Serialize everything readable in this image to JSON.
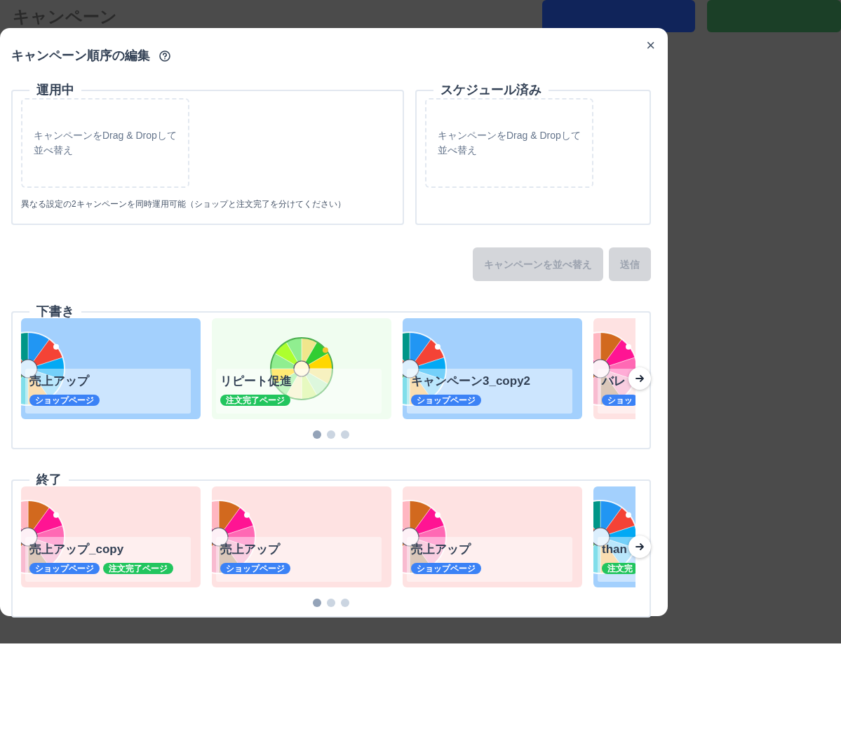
{
  "background": {
    "title": "キャンペーン"
  },
  "modal": {
    "title": "キャンペーン順序の編集",
    "close": "×"
  },
  "sections": [
    {
      "legend": "運用中",
      "drop_text": "キャンペーンをDrag & Dropして並べ替え",
      "note": "異なる設定の2キャンペーンを同時運用可能（ショップと注文完了を分けてください）"
    },
    {
      "legend": "スケジュール済み",
      "drop_text": "キャンペーンをDrag & Dropして並べ替え"
    }
  ],
  "buttons": [
    {
      "label": "キャンペーンを並べ替え",
      "disabled": true
    },
    {
      "label": "送信",
      "disabled": true
    }
  ],
  "carousels": [
    {
      "legend": "下書き",
      "cards": [
        {
          "title": "売上アップ",
          "color": "#a3d0fd",
          "kind": "blue",
          "tags": [
            {
              "label": "ショップページ",
              "kind": "shop"
            }
          ]
        },
        {
          "title": "リピート促進",
          "color": "#f0fdf0",
          "kind": "green",
          "tags": [
            {
              "label": "注文完了ページ",
              "kind": "order"
            }
          ]
        },
        {
          "title": "キャンペーン3_copy2",
          "color": "#a3d0fd",
          "kind": "blue",
          "tags": [
            {
              "label": "ショップページ",
              "kind": "shop"
            }
          ]
        },
        {
          "title": "バレ",
          "color": "#fee2e2",
          "kind": "pink",
          "tags": [
            {
              "label": "ショッ",
              "kind": "shop"
            }
          ]
        }
      ],
      "dots": [
        {
          "selected": true
        },
        {
          "selected": false
        },
        {
          "selected": false
        }
      ]
    },
    {
      "legend": "終了",
      "cards": [
        {
          "title": "売上アップ_copy",
          "color": "#fee2e2",
          "kind": "pink",
          "tags": [
            {
              "label": "ショップページ",
              "kind": "shop"
            },
            {
              "label": "注文完了ページ",
              "kind": "order"
            }
          ]
        },
        {
          "title": "売上アップ",
          "color": "#fee2e2",
          "kind": "pink",
          "tags": [
            {
              "label": "ショップページ",
              "kind": "shop"
            }
          ]
        },
        {
          "title": "売上アップ",
          "color": "#fee2e2",
          "kind": "pink",
          "tags": [
            {
              "label": "ショップページ",
              "kind": "shop"
            }
          ]
        },
        {
          "title": "than",
          "color": "#a3d0fd",
          "kind": "blue",
          "tags": [
            {
              "label": "注文完",
              "kind": "order"
            }
          ]
        }
      ],
      "dots": [
        {
          "selected": true
        },
        {
          "selected": false
        },
        {
          "selected": false
        }
      ]
    }
  ]
}
